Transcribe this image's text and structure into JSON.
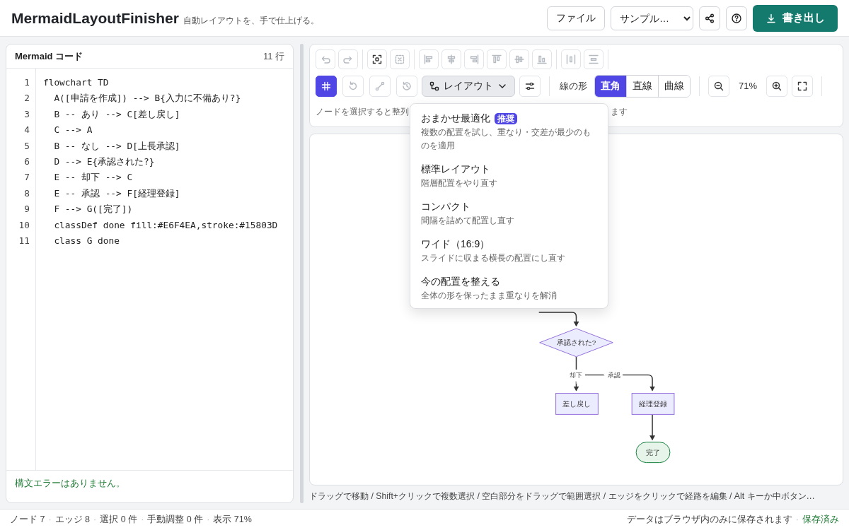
{
  "app": {
    "title": "MermaidLayoutFinisher",
    "tagline": "自動レイアウトを、手で仕上げる。"
  },
  "header_actions": {
    "file_button": "ファイル",
    "sample_select": "サンプル…",
    "export_button": "書き出し"
  },
  "editor": {
    "title": "Mermaid コード",
    "line_count": "11 行",
    "lines": [
      {
        "number": "1",
        "code": "flowchart TD"
      },
      {
        "number": "2",
        "code": "  A([申請を作成]) --> B{入力に不備あり?}"
      },
      {
        "number": "3",
        "code": "  B -- あり --> C[差し戻し]"
      },
      {
        "number": "4",
        "code": "  C --> A"
      },
      {
        "number": "5",
        "code": "  B -- なし --> D[上長承認]"
      },
      {
        "number": "6",
        "code": "  D --> E{承認された?}"
      },
      {
        "number": "7",
        "code": "  E -- 却下 --> C"
      },
      {
        "number": "8",
        "code": "  E -- 承認 --> F[経理登録]"
      },
      {
        "number": "9",
        "code": "  F --> G([完了])"
      },
      {
        "number": "10",
        "code": "  classDef done fill:#E6F4EA,stroke:#15803D"
      },
      {
        "number": "11",
        "code": "  class G done"
      }
    ],
    "status": "構文エラーはありません。"
  },
  "toolbar": {
    "row1": [
      [
        {
          "kind": "undo",
          "disabled": true
        },
        {
          "kind": "redo",
          "disabled": true
        }
      ],
      [
        {
          "kind": "fit",
          "disabled": false
        },
        {
          "kind": "deselect",
          "disabled": true
        }
      ],
      [
        {
          "kind": "align-left",
          "disabled": true
        },
        {
          "kind": "align-center",
          "disabled": true
        },
        {
          "kind": "align-right",
          "disabled": true
        },
        {
          "kind": "align-top",
          "disabled": true
        },
        {
          "kind": "align-middle",
          "disabled": true
        },
        {
          "kind": "align-bottom",
          "disabled": true
        }
      ],
      [
        {
          "kind": "distribute-h",
          "disabled": true
        },
        {
          "kind": "distribute-v",
          "disabled": true
        }
      ]
    ],
    "row2_tools": [
      {
        "kind": "grid",
        "selected": true,
        "disabled": false
      },
      {
        "kind": "reset",
        "selected": false,
        "disabled": true
      },
      {
        "kind": "route",
        "selected": false,
        "disabled": true
      },
      {
        "kind": "history",
        "selected": false,
        "disabled": true
      }
    ],
    "layout_button": {
      "label": "レイアウト",
      "expanded": true
    },
    "line_shape": {
      "label": "線の形",
      "options": [
        {
          "label": "直角",
          "selected": true
        },
        {
          "label": "直線",
          "selected": false
        },
        {
          "label": "曲線",
          "selected": false
        }
      ]
    },
    "zoom": "71%",
    "hint_start": "ノードを選択すると整列",
    "hint_end": "ます"
  },
  "layout_menu": [
    {
      "label": "おまかせ最適化",
      "badge": "推奨",
      "description": "複数の配置を試し、重なり・交差が最少のものを適用"
    },
    {
      "label": "標準レイアウト",
      "description": "階層配置をやり直す"
    },
    {
      "label": "コンパクト",
      "description": "間隔を詰めて配置し直す"
    },
    {
      "label": "ワイド（16:9）",
      "description": "スライドに収まる横長の配置にし直す"
    },
    {
      "label": "今の配置を整える",
      "description": "全体の形を保ったまま重なりを解消"
    }
  ],
  "diagram": {
    "nodes": [
      {
        "kind": "decision",
        "label": "承認された?"
      },
      {
        "kind": "process",
        "label": "差し戻し"
      },
      {
        "kind": "process",
        "label": "経理登録"
      },
      {
        "kind": "terminal",
        "label": "完了",
        "color": "#e6f4ea"
      }
    ],
    "edge_labels": [
      "却下",
      "承認"
    ]
  },
  "canvas_hint": "ドラッグで移動 / Shift+クリックで複数選択 / 空白部分をドラッグで範囲選択 / エッジをクリックで経路を編集 / Alt キーか中ボタン…",
  "status_bar": {
    "items": [
      {
        "kind": "count",
        "text": "ノード 7"
      },
      {
        "kind": "separator",
        "text": "·"
      },
      {
        "kind": "count",
        "text": "エッジ 8"
      },
      {
        "kind": "separator",
        "text": "·"
      },
      {
        "kind": "count",
        "text": "選択 0 件"
      },
      {
        "kind": "separator",
        "text": "·"
      },
      {
        "kind": "count",
        "text": "手動調整 0 件"
      },
      {
        "kind": "separator",
        "text": "·"
      },
      {
        "kind": "count",
        "text": "表示 71%"
      }
    ],
    "storage_note": "データはブラウザ内のみに保存されます",
    "separator": "·",
    "saved": "保存済み"
  }
}
